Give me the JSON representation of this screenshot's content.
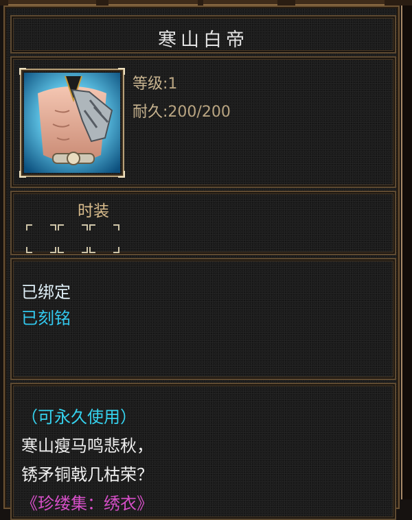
{
  "item": {
    "name": "寒山白帝",
    "stats": {
      "level_label": "等级:",
      "level_value": "1",
      "durability_label": "耐久:",
      "durability_value": "200/200"
    },
    "fashion_label": "时装",
    "fashion_slots": 3,
    "binding": {
      "bound": "已绑定",
      "engraved": "已刻铭"
    },
    "description": {
      "permanent": "（可永久使用）",
      "line1": "寒山瘦马鸣悲秋，",
      "line2": "锈矛铜戟几枯荣？",
      "source": "《珍缕集：绣衣》"
    }
  },
  "colors": {
    "title": "#e3e3e3",
    "stat_label": "#c8b490",
    "fashion_label": "#d9bc8c",
    "bound": "#dfeff7",
    "engraved": "#32c8ee",
    "permanent": "#35d3ef",
    "description": "#f0f0f0",
    "source": "#d64fc8"
  },
  "icons": {
    "portrait": "armor-portrait-icon",
    "slot": "empty-slot-icon"
  }
}
